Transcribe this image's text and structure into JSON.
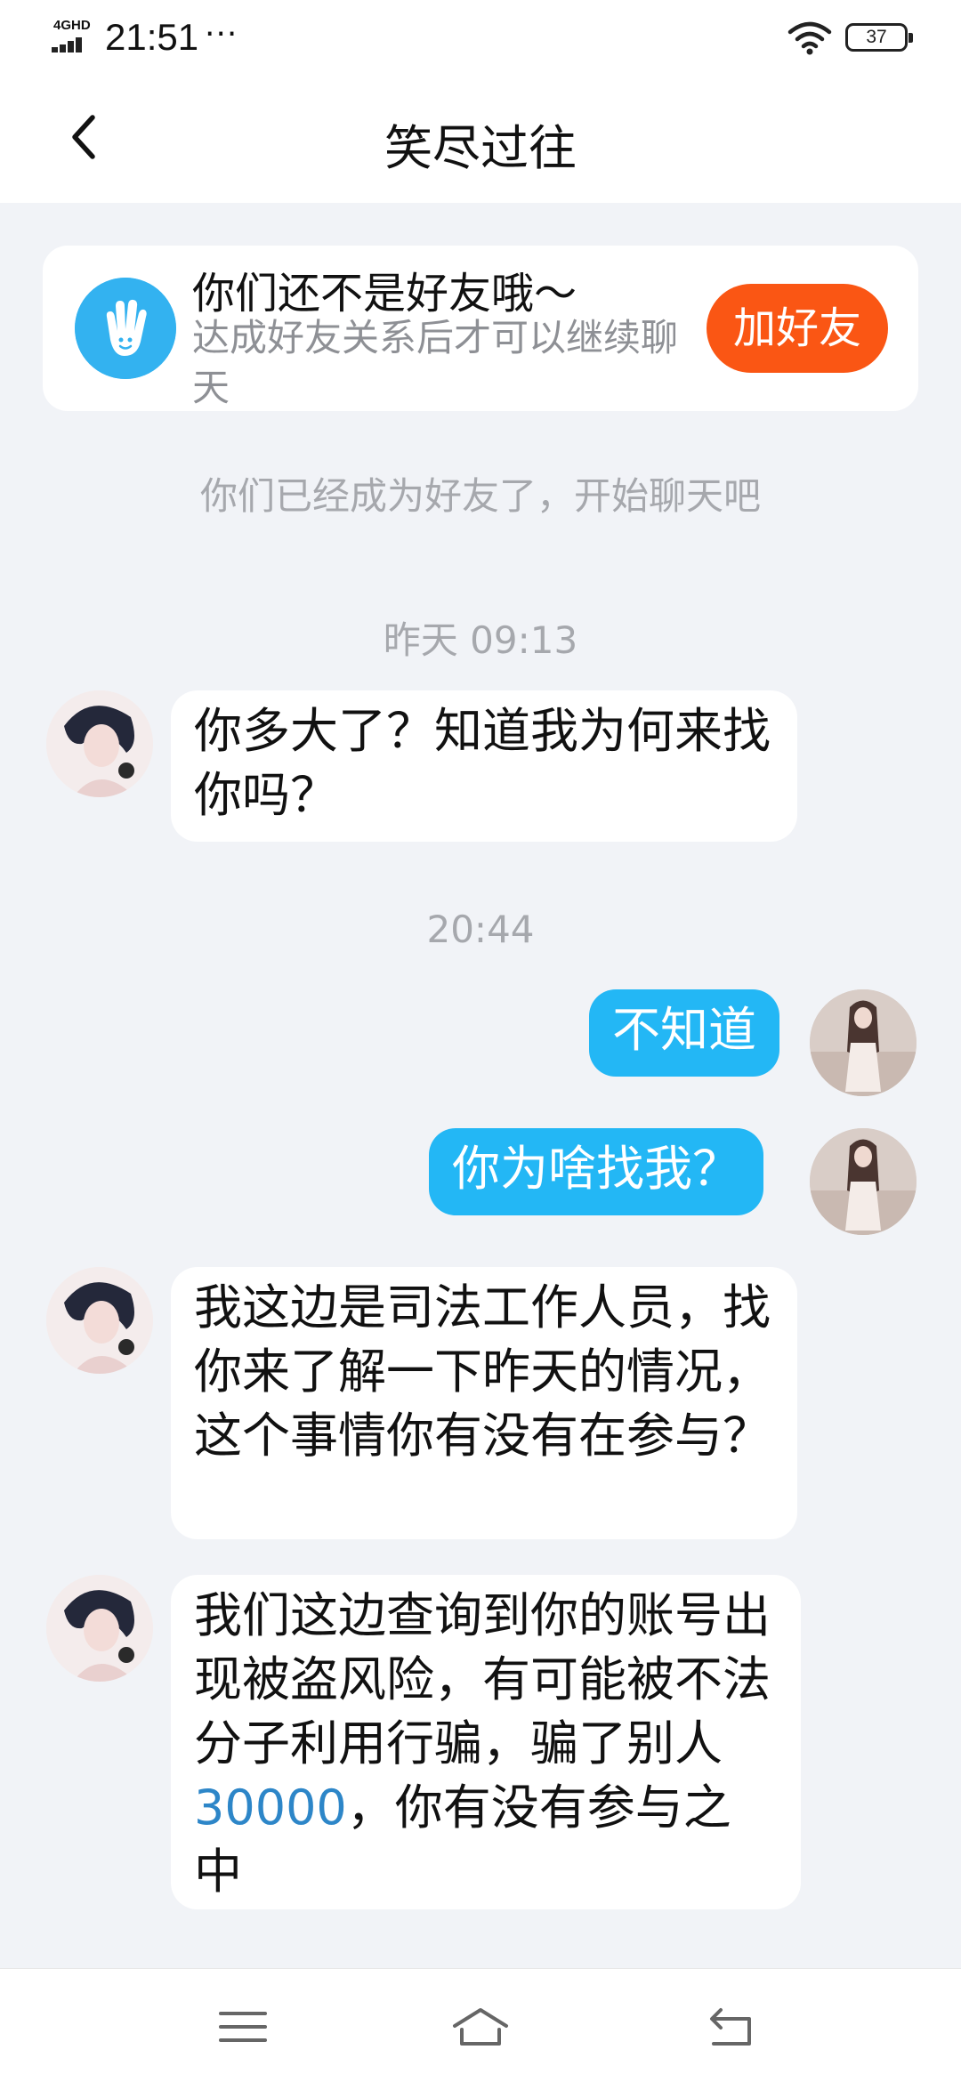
{
  "status_bar": {
    "network": "4GHD",
    "time": "21:51",
    "more": "···",
    "battery": "37"
  },
  "header": {
    "title": "笑尽过往"
  },
  "friend_notice": {
    "title": "你们还不是好友哦～",
    "subtitle": "达成好友关系后才可以继续聊天",
    "add_button": "加好友",
    "accent_color": "#fa5614",
    "icon": "hand-wave-icon"
  },
  "system_message": "你们已经成为好友了，开始聊天吧",
  "messages": [
    {
      "type": "timestamp",
      "text": "昨天 09:13"
    },
    {
      "type": "incoming",
      "text": "你多大了？知道我为何来找你吗？"
    },
    {
      "type": "timestamp",
      "text": "20:44"
    },
    {
      "type": "outgoing",
      "text": "不知道"
    },
    {
      "type": "outgoing",
      "text": "你为啥找我？"
    },
    {
      "type": "incoming",
      "text": "我这边是司法工作人员，找你来了解一下昨天的情况，这个事情你有没有在参与？"
    },
    {
      "type": "incoming",
      "text_before": "我们这边查询到你的账号出现被盗风险，有可能被不法分子利用行骗，骗了别人",
      "highlight": "30000",
      "text_after": "，你有没有参与之中"
    }
  ],
  "colors": {
    "outgoing_bubble": "#23b7f5",
    "incoming_bubble": "#ffffff",
    "background": "#f1f3f7",
    "link": "#2d86c8"
  },
  "nav": {
    "menu_icon": "menu-icon",
    "home_icon": "home-icon",
    "back_icon": "back-icon"
  }
}
